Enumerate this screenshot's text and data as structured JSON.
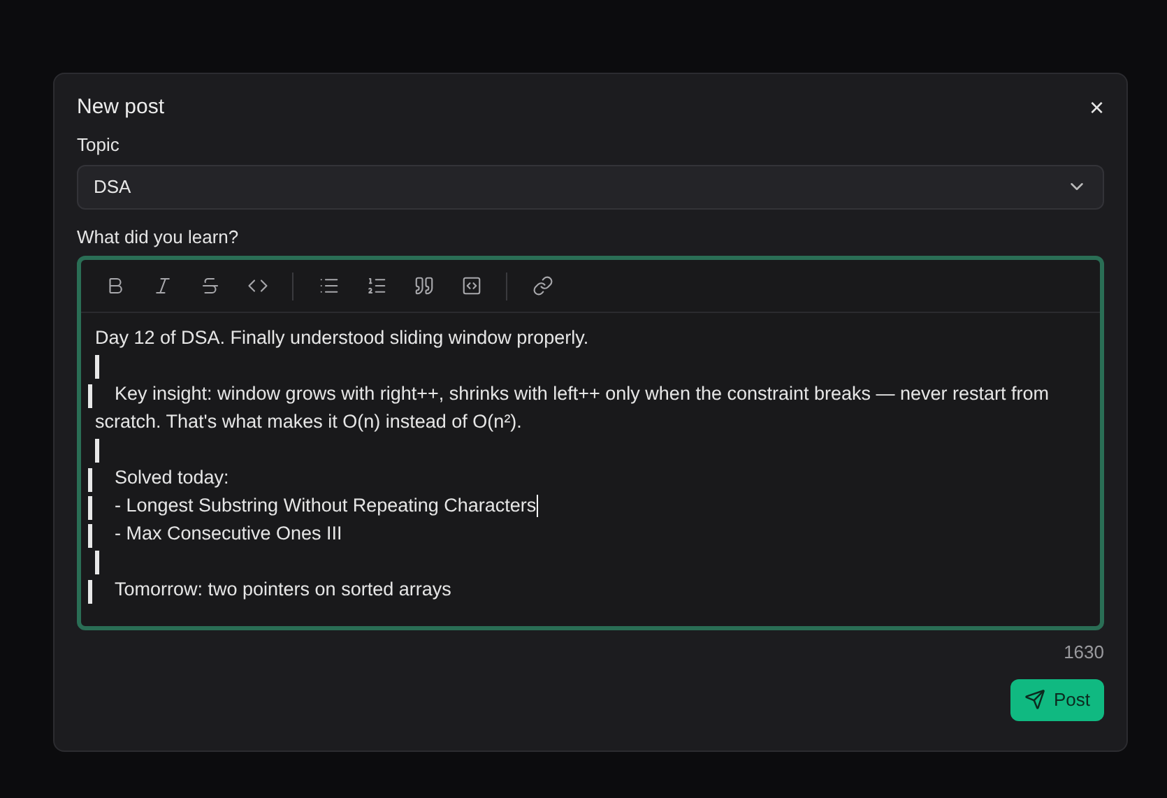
{
  "dialog": {
    "title": "New post",
    "close": "×"
  },
  "topic": {
    "label": "Topic",
    "value": "DSA"
  },
  "editor": {
    "label": "What did you learn?",
    "toolbar": [
      {
        "kind": "bold"
      },
      {
        "kind": "italic"
      },
      {
        "kind": "strike"
      },
      {
        "kind": "code"
      },
      {
        "kind": "divider"
      },
      {
        "kind": "bullets"
      },
      {
        "kind": "numbers"
      },
      {
        "kind": "quote"
      },
      {
        "kind": "codeblock"
      },
      {
        "kind": "divider"
      },
      {
        "kind": "link"
      }
    ],
    "lines": [
      {
        "kind": "text",
        "bar": false,
        "text": "Day 12 of DSA. Finally understood sliding window properly.",
        "caret": false
      },
      {
        "kind": "bar"
      },
      {
        "kind": "text",
        "bar": true,
        "text": "Key insight: window grows with right++, shrinks with left++ only when the constraint breaks — never restart from scratch. That's what makes it O(n) instead of O(n²).",
        "caret": false
      },
      {
        "kind": "bar"
      },
      {
        "kind": "text",
        "bar": true,
        "text": "Solved today:",
        "caret": false
      },
      {
        "kind": "text",
        "bar": true,
        "text": "- Longest Substring Without Repeating Characters",
        "caret": true
      },
      {
        "kind": "text",
        "bar": true,
        "text": "- Max Consecutive Ones III",
        "caret": false
      },
      {
        "kind": "bar"
      },
      {
        "kind": "text",
        "bar": true,
        "text": "Tomorrow: two pointers on sorted arrays",
        "caret": false
      }
    ],
    "count": "1630"
  },
  "submit": {
    "label": "Post"
  }
}
